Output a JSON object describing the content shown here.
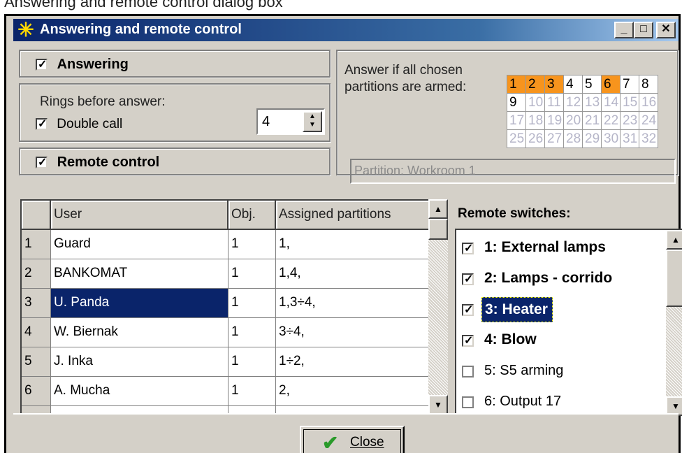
{
  "top_strip_text": "Answering and remote control dialog box",
  "window": {
    "title": "Answering and remote control",
    "title_icon": "asterisk-icon",
    "minimize": "_",
    "maximize": "□",
    "close": "✕"
  },
  "answering": {
    "label": "Answering",
    "checked": true,
    "rings_label": "Rings before answer:",
    "rings_value": "4",
    "double_call_label": "Double call",
    "double_call_checked": true
  },
  "remote_control": {
    "label": "Remote control",
    "checked": true
  },
  "partitions": {
    "caption_line1": "Answer if all chosen",
    "caption_line2": "partitions are armed:",
    "cells": [
      "1",
      "2",
      "3",
      "4",
      "5",
      "6",
      "7",
      "8",
      "9",
      "10",
      "11",
      "12",
      "13",
      "14",
      "15",
      "16",
      "17",
      "18",
      "19",
      "20",
      "21",
      "22",
      "23",
      "24",
      "25",
      "26",
      "27",
      "28",
      "29",
      "30",
      "31",
      "32"
    ],
    "selected": [
      "1",
      "2",
      "3",
      "6"
    ],
    "enabled": [
      "1",
      "2",
      "3",
      "4",
      "5",
      "6",
      "7",
      "8",
      "9"
    ],
    "info": "Partition: Workroom 1",
    "selected_color": "#f7941d"
  },
  "users_table": {
    "headers": [
      "",
      "User",
      "Obj.",
      "Assigned partitions"
    ],
    "rows": [
      {
        "num": "1",
        "user": "Guard",
        "obj": "1",
        "parts": "1,"
      },
      {
        "num": "2",
        "user": "BANKOMAT",
        "obj": "1",
        "parts": "1,4,"
      },
      {
        "num": "3",
        "user": "U. Panda",
        "obj": "1",
        "parts": "1,3÷4,"
      },
      {
        "num": "4",
        "user": "W. Biernak",
        "obj": "1",
        "parts": "3÷4,"
      },
      {
        "num": "5",
        "user": "J. Inka",
        "obj": "1",
        "parts": "1÷2,"
      },
      {
        "num": "6",
        "user": "A. Mucha",
        "obj": "1",
        "parts": "2,"
      }
    ],
    "selected_row": "3"
  },
  "remote_switches": {
    "title": "Remote switches:",
    "items": [
      {
        "label": "1: External lamps",
        "checked": true,
        "bold": true
      },
      {
        "label": "2: Lamps - corrido",
        "checked": true,
        "bold": true
      },
      {
        "label": "3: Heater",
        "checked": true,
        "bold": true,
        "selected": true
      },
      {
        "label": "4: Blow",
        "checked": true,
        "bold": true
      },
      {
        "label": "5: S5 arming",
        "checked": false,
        "bold": false
      },
      {
        "label": "6: Output 17",
        "checked": false,
        "bold": false
      }
    ]
  },
  "footer": {
    "close_label": "Close"
  },
  "colors": {
    "title_bar": "#0a246a",
    "selection": "#0a246a",
    "face": "#d4d0c8"
  }
}
